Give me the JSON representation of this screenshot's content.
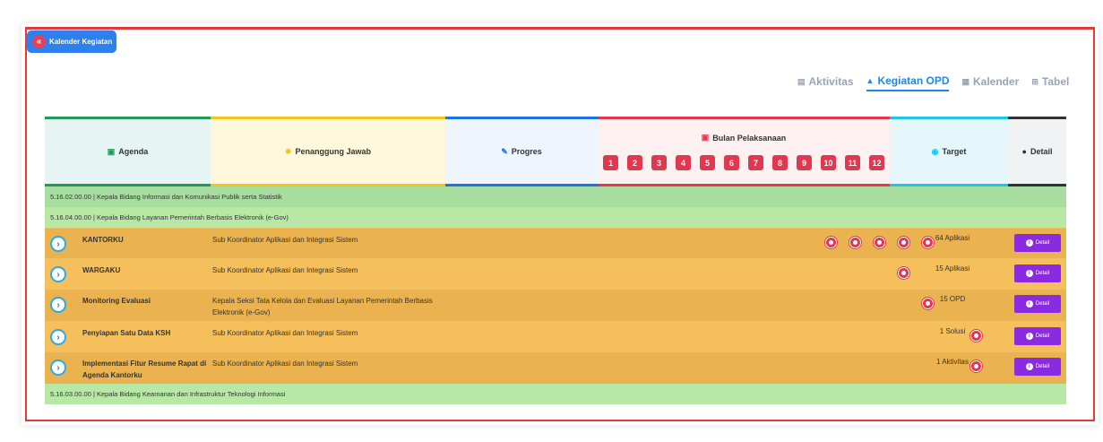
{
  "header_button": {
    "label": "Kalender Kegiatan",
    "icon": "double-chevron-left-icon"
  },
  "tabs": [
    {
      "label": "Aktivitas",
      "icon": "list-icon",
      "active": false
    },
    {
      "label": "Kegiatan OPD",
      "icon": "building-icon",
      "active": true
    },
    {
      "label": "Kalender",
      "icon": "calendar-icon",
      "active": false
    },
    {
      "label": "Tabel",
      "icon": "table-icon",
      "active": false
    }
  ],
  "columns": {
    "agenda": "Agenda",
    "penanggung_jawab": "Penanggung Jawab",
    "progres": "Progres",
    "bulan": "Bulan Pelaksanaan",
    "target": "Target",
    "detail": "Detail"
  },
  "months": [
    "1",
    "2",
    "3",
    "4",
    "5",
    "6",
    "7",
    "8",
    "9",
    "10",
    "11",
    "12"
  ],
  "sections": [
    "5.16.02.00.00 | Kepala Bidang Informasi dan Komunikasi Publik serta Statistik",
    "5.16.04.00.00 | Kepala Bidang Layanan Pemerintah Berbasis Elektronik (e-Gov)",
    "5.16.03.00.00 | Kepala Bidang Keamanan dan Infrastruktur Teknologi Informasi"
  ],
  "rows": [
    {
      "name": "KANTORKU",
      "pj": "Sub Koordinator Aplikasi dan Integrasi Sistem",
      "months": [
        6,
        7,
        8,
        9,
        10
      ],
      "target": "64 Aplikasi",
      "detail": "Detail"
    },
    {
      "name": "WARGAKU",
      "pj": "Sub Koordinator Aplikasi dan Integrasi Sistem",
      "months": [
        9
      ],
      "target": "15 Aplikasi",
      "detail": "Detail"
    },
    {
      "name": "Monitoring Evaluasi",
      "pj": "Kepala Seksi Tata Kelola dan Evaluasi Layanan Pemerintah Berbasis Elektronik (e-Gov)",
      "months": [
        10
      ],
      "target": "15 OPD",
      "detail": "Detail"
    },
    {
      "name": "Penyiapan Satu Data KSH",
      "pj": "Sub Koordinator Aplikasi dan Integrasi Sistem",
      "months": [
        12
      ],
      "target": "1 Solusi",
      "detail": "Detail"
    },
    {
      "name": "Implementasi Fitur Resume Rapat di Agenda Kantorku",
      "pj": "Sub Koordinator Aplikasi dan Integrasi Sistem",
      "months": [
        12
      ],
      "target": "1 Aktivitas",
      "detail": "Detail"
    }
  ],
  "colors": {
    "primary": "#2f80ed",
    "accent_red": "#e0384e",
    "detail_button": "#8a2be2",
    "row_orange": "#f5bf5b",
    "section_green": "#b8e8a6"
  }
}
